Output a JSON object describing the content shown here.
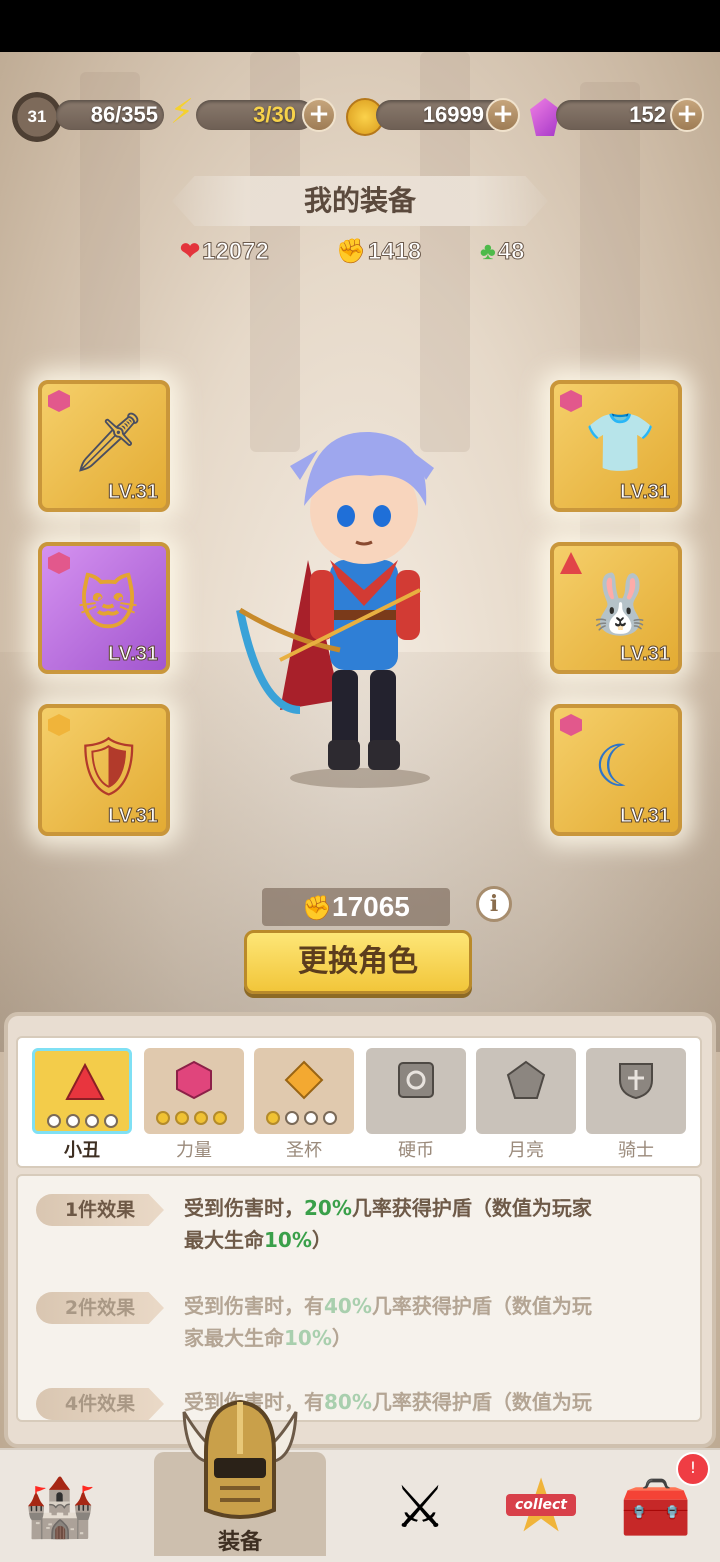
{
  "status": {
    "level": "31",
    "exp": "86/355",
    "energy": "3/30",
    "coins": "16999",
    "gems": "152",
    "plus": "+"
  },
  "title": "我的装备",
  "stats": {
    "hp": "12072",
    "attack": "1418",
    "luck": "48"
  },
  "equipment": {
    "left": [
      {
        "level": "LV.31"
      },
      {
        "level": "LV.31"
      },
      {
        "level": "LV.31"
      }
    ],
    "right": [
      {
        "level": "LV.31"
      },
      {
        "level": "LV.31"
      },
      {
        "level": "LV.31"
      }
    ]
  },
  "power": "17065",
  "info_icon": "i",
  "change_button": "更换角色",
  "sets": [
    {
      "name": "小丑"
    },
    {
      "name": "力量"
    },
    {
      "name": "圣杯"
    },
    {
      "name": "硬币"
    },
    {
      "name": "月亮"
    },
    {
      "name": "骑士"
    }
  ],
  "effects": [
    {
      "tag": "1件效果",
      "pre": "受到伤害时，",
      "pct": "20%",
      "mid": "几率获得护盾（数值为玩家",
      "line2pre": "最大生命",
      "line2pct": "10%",
      "line2post": "）"
    },
    {
      "tag": "2件效果",
      "pre": "受到伤害时，有",
      "pct": "40%",
      "mid": "几率获得护盾（数值为玩",
      "line2pre": "家最大生命",
      "line2pct": "10%",
      "line2post": "）"
    },
    {
      "tag": "4件效果",
      "pre": "受到伤害时，有",
      "pct": "80%",
      "mid": "几率获得护盾（数值为玩"
    }
  ],
  "nav": {
    "equipment_label": "装备",
    "collect_label": "collect",
    "chest_badge": "!"
  },
  "colors": {
    "accent_gold": "#f2c63a",
    "highlight_green": "#3aa04a",
    "purple_slot": "#a256cf"
  }
}
